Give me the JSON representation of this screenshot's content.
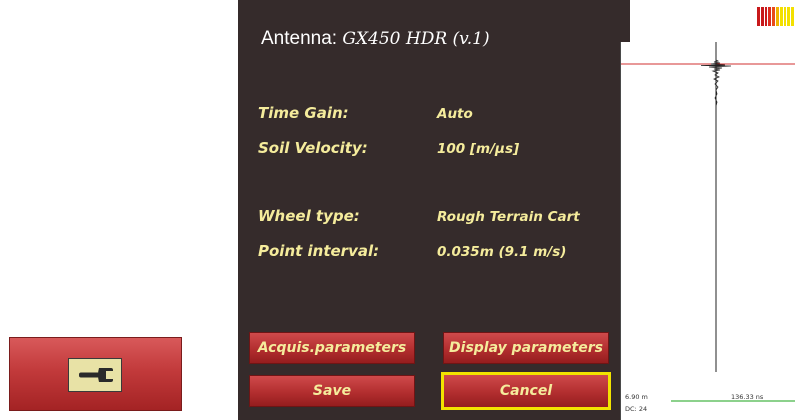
{
  "panel": {
    "antenna_label": "Antenna:",
    "antenna_model": "GX450 HDR (v.1)",
    "params": [
      {
        "label": "Time Gain:",
        "value": "Auto"
      },
      {
        "label": "Soil Velocity:",
        "value": "100 [m/µs]"
      },
      {
        "label": "Wheel type:",
        "value": "Rough Terrain Cart"
      },
      {
        "label": "Point interval:",
        "value": "0.035m (9.1 m/s)"
      }
    ]
  },
  "buttons": {
    "acquis": "Acquis.parameters",
    "display": "Display parameters",
    "save": "Save",
    "cancel": "Cancel",
    "selected": "cancel"
  },
  "side_button": {
    "icon": "wrench-icon"
  },
  "signal_meter": {
    "icon": "signal-level-meter",
    "colors": [
      "#c8191b",
      "#c8191b",
      "#c8191b",
      "#dc2a1e",
      "#e84a1a",
      "#f0b400",
      "#f3e000",
      "#f3e000",
      "#f3e000",
      "#f3e000"
    ]
  },
  "radar": {
    "distance": "6.90 m",
    "time": "136.33 ns",
    "dc_label": "DC:",
    "dc_value": "24",
    "colors": {
      "marker_line": "#d03030",
      "trace": "#222222",
      "time_line": "#1aa31a"
    }
  },
  "colors": {
    "panel_bg": "#352b2b",
    "label_text": "#f5ec9c",
    "button_red": "#b22e2f",
    "highlight": "#f2e300"
  }
}
